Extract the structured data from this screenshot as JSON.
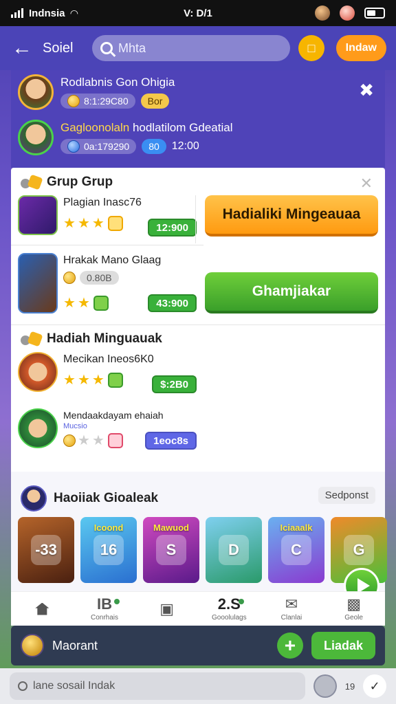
{
  "status_bar": {
    "carrier": "Indnsia",
    "time": "V: D/1"
  },
  "top_nav": {
    "title": "Soiel",
    "search_text": "Mhta",
    "action_label": "Indaw"
  },
  "notifications": [
    {
      "name": "Rodlabnis Gon Ohigia",
      "amount": "8:1:29C80",
      "badge": "Bor"
    },
    {
      "name_highlight": "Gagloonolaln",
      "name_rest": "hodlatilom Gdeatial",
      "amount": "0a:179290",
      "badge": "80",
      "time": "12:00"
    }
  ],
  "grup_section": {
    "title": "Grup Grup",
    "items": [
      {
        "title": "Plagian Inasc76",
        "price": "12:900"
      },
      {
        "title": "Hrakak Mano Glaag",
        "chip": "0.80B",
        "price": "43:900"
      }
    ],
    "primary_button": "Hadialiki Mingeauaa",
    "secondary_button": "Ghamjiakar"
  },
  "hadiah_section": {
    "title": "Hadiah Minguauak",
    "items": [
      {
        "title": "Mecikan Ineos6K0",
        "price": "$:2B0"
      },
      {
        "title": "Mendaakdayam ehaiah",
        "sub": "Mucsio",
        "price": "1eoc8s"
      }
    ]
  },
  "gallery": {
    "title": "Haoiiak Gioaleak",
    "see_all": "Sedponst",
    "tiles": [
      {
        "tag": "",
        "glyph": "-33"
      },
      {
        "tag": "Icoond",
        "glyph": "16"
      },
      {
        "tag": "Mawuod",
        "glyph": "S"
      },
      {
        "tag": "",
        "glyph": "D"
      },
      {
        "tag": "Iciaaalk",
        "glyph": "C"
      },
      {
        "tag": "",
        "glyph": "G"
      }
    ]
  },
  "bottom_nav": [
    {
      "icon": "",
      "label": ""
    },
    {
      "icon": "IB",
      "label": "Conrhais"
    },
    {
      "icon": "",
      "label": ""
    },
    {
      "icon": "2.S",
      "label": "Gooolulags"
    },
    {
      "icon": "",
      "label": "Clanlai"
    },
    {
      "icon": "",
      "label": "Geole"
    }
  ],
  "action_bar": {
    "label": "Maorant",
    "button": "Liadak"
  },
  "composer": {
    "placeholder": "lane sosail Indak",
    "count": "19"
  },
  "colors": {
    "header": "#4b44b7",
    "orange": "#ff9a10",
    "green": "#3a9f2a",
    "violet": "#5f67e6"
  }
}
